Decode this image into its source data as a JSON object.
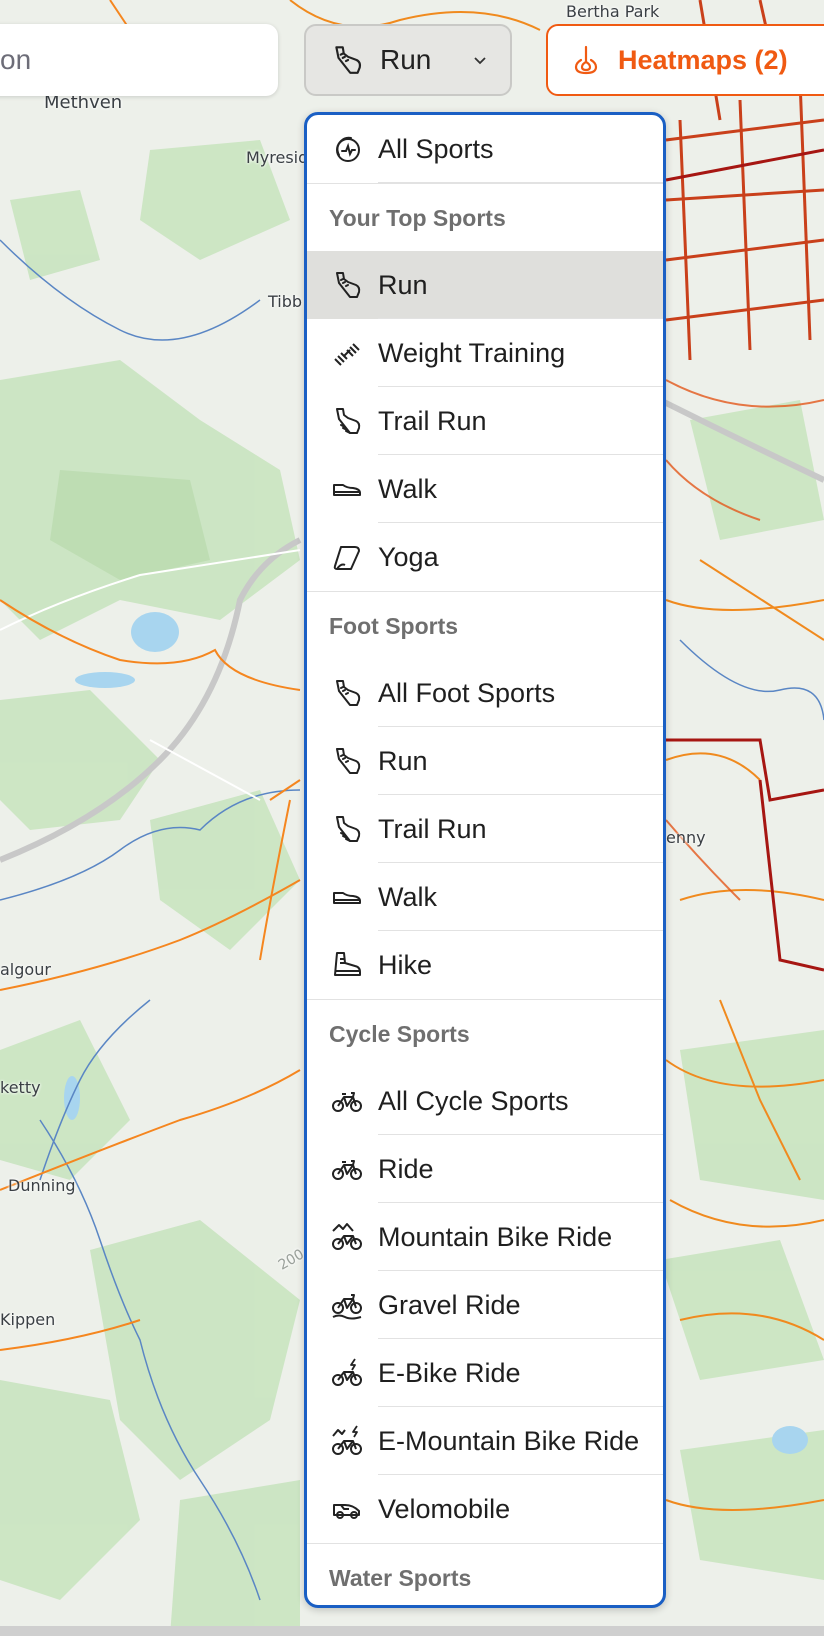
{
  "map": {
    "labels": [
      "Bertha Park",
      "Methven",
      "Myresid",
      "Tibb",
      "algour",
      "ketty",
      "Dunning",
      "Kippen",
      "enny",
      "200"
    ]
  },
  "search": {
    "partial_text": "on"
  },
  "sport_button": {
    "label": "Run",
    "icon": "run-shoe-icon"
  },
  "heatmaps_button": {
    "label": "Heatmaps (2)",
    "icon": "heat-icon",
    "color": "#f05a12"
  },
  "dropdown": {
    "border_color": "#1a5fc4",
    "all_sports": "All Sports",
    "sections": [
      {
        "header": "Your Top Sports",
        "items": [
          "Run",
          "Weight Training",
          "Trail Run",
          "Walk",
          "Yoga"
        ]
      },
      {
        "header": "Foot Sports",
        "items": [
          "All Foot Sports",
          "Run",
          "Trail Run",
          "Walk",
          "Hike"
        ]
      },
      {
        "header": "Cycle Sports",
        "items": [
          "All Cycle Sports",
          "Ride",
          "Mountain Bike Ride",
          "Gravel Ride",
          "E-Bike Ride",
          "E-Mountain Bike Ride",
          "Velomobile"
        ]
      },
      {
        "header": "Water Sports",
        "items": []
      }
    ],
    "selected": "Run"
  }
}
